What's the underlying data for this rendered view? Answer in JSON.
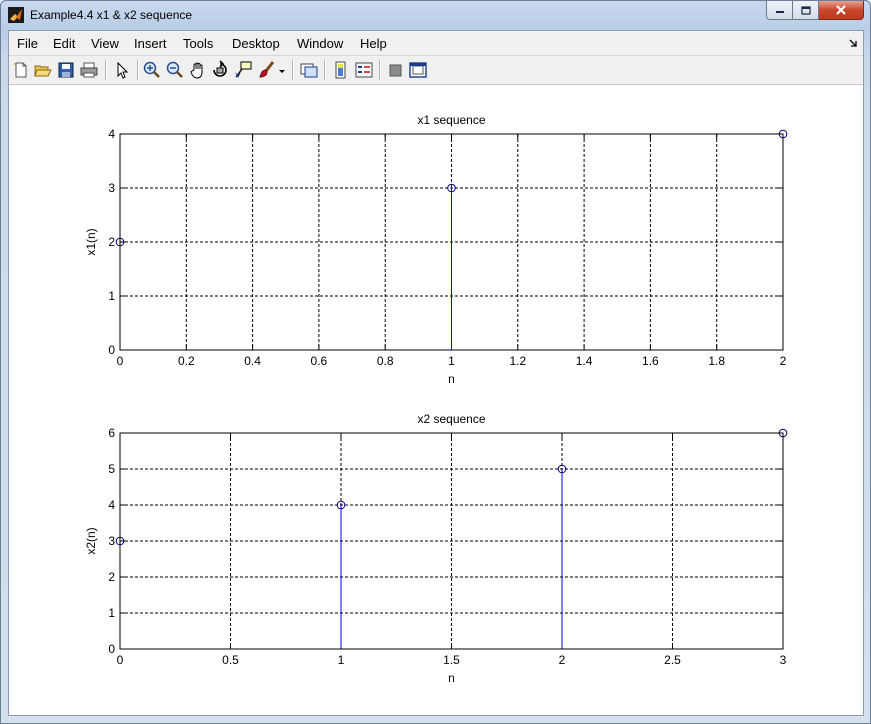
{
  "window": {
    "title": "Example4.4 x1 & x2 sequence",
    "colors": {
      "close_button": "#c9462c",
      "stem": "#0000ff",
      "marker": "#00007f"
    }
  },
  "menu": [
    "File",
    "Edit",
    "View",
    "Insert",
    "Tools",
    "Desktop",
    "Window",
    "Help"
  ],
  "toolbar_icons": [
    "new-figure-icon",
    "open-file-icon",
    "save-icon",
    "print-icon",
    "edit-plot-arrow-icon",
    "zoom-in-icon",
    "zoom-out-icon",
    "pan-hand-icon",
    "rotate-3d-icon",
    "data-cursor-icon",
    "brush-icon",
    "brush-dropdown-icon",
    "link-plot-icon",
    "insert-colorbar-icon",
    "insert-legend-icon",
    "hide-plot-tools-icon",
    "show-plot-tools-icon"
  ],
  "chart_data": [
    {
      "type": "stem",
      "title": "x1 sequence",
      "xlabel": "n",
      "ylabel": "x1(n)",
      "x": [
        0,
        1,
        2
      ],
      "y": [
        2,
        3,
        4
      ],
      "xlim": [
        0,
        2
      ],
      "ylim": [
        0,
        4
      ],
      "xticks": [
        0,
        0.2,
        0.4,
        0.6,
        0.8,
        1,
        1.2,
        1.4,
        1.6,
        1.8,
        2
      ],
      "xtick_labels": [
        "0",
        "0.2",
        "0.4",
        "0.6",
        "0.8",
        "1",
        "1.2",
        "1.4",
        "1.6",
        "1.8",
        "2"
      ],
      "yticks": [
        0,
        1,
        2,
        3,
        4
      ],
      "ytick_labels": [
        "0",
        "1",
        "2",
        "3",
        "4"
      ],
      "grid": true
    },
    {
      "type": "stem",
      "title": "x2 sequence",
      "xlabel": "n",
      "ylabel": "x2(n)",
      "x": [
        0,
        1,
        2,
        3
      ],
      "y": [
        3,
        4,
        5,
        6
      ],
      "xlim": [
        0,
        3
      ],
      "ylim": [
        0,
        6
      ],
      "xticks": [
        0,
        0.5,
        1,
        1.5,
        2,
        2.5,
        3
      ],
      "xtick_labels": [
        "0",
        "0.5",
        "1",
        "1.5",
        "2",
        "2.5",
        "3"
      ],
      "yticks": [
        0,
        1,
        2,
        3,
        4,
        5,
        6
      ],
      "ytick_labels": [
        "0",
        "1",
        "2",
        "3",
        "4",
        "5",
        "6"
      ],
      "grid": true
    }
  ]
}
